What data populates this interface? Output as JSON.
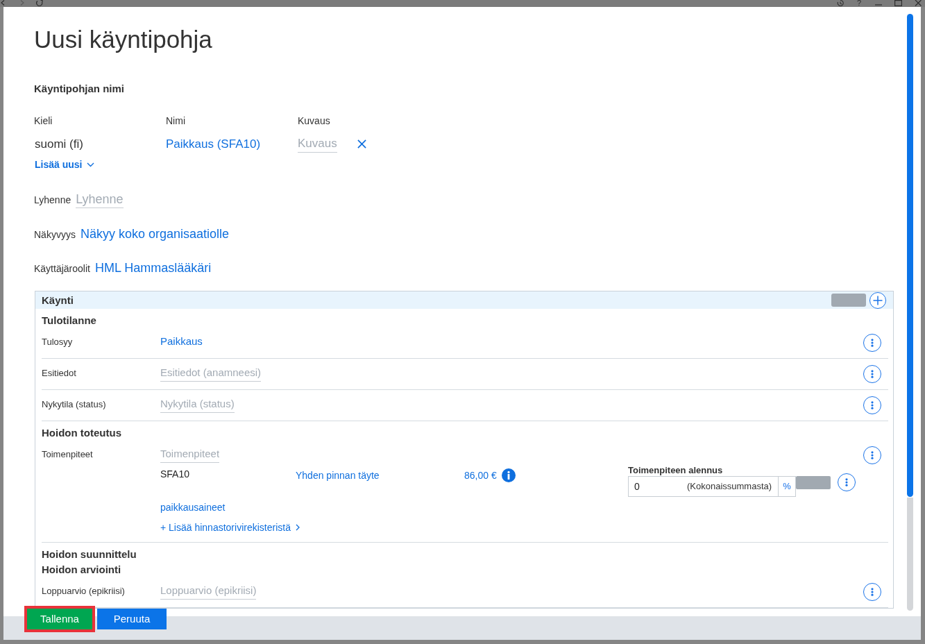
{
  "browser_toolbar": {
    "help": "?"
  },
  "dialog": {
    "title": "Uusi käyntipohja"
  },
  "name_section": {
    "heading": "Käyntipohjan nimi",
    "columns": [
      "Kieli",
      "Nimi",
      "Kuvaus"
    ],
    "rows": [
      {
        "language": "suomi (fi)",
        "name": "Paikkaus (SFA10)",
        "description": {
          "placeholder": "Kuvaus"
        }
      }
    ],
    "add_new": "Lisää uusi"
  },
  "fields": [
    {
      "label": "Lyhenne",
      "kind": "input",
      "placeholder": "Lyhenne"
    },
    {
      "label": "Näkyvyys",
      "kind": "link",
      "value": "Näkyy koko organisaatiolle"
    },
    {
      "label": "Käyttäjäroolit",
      "kind": "link",
      "value": "HML Hammaslääkäri"
    }
  ],
  "panel": {
    "title": "Käynti",
    "groups": [
      {
        "heading": "Tulotilanne",
        "rows": [
          {
            "label": "Tulosyy",
            "kind": "link",
            "value": "Paikkaus"
          },
          {
            "label": "Esitiedot",
            "kind": "input",
            "placeholder": "Esitiedot (anamneesi)"
          },
          {
            "label": "Nykytila (status)",
            "kind": "input",
            "placeholder": "Nykytila (status)"
          }
        ]
      },
      {
        "heading": "Hoidon toteutus",
        "rows": [
          {
            "label": "Toimenpiteet",
            "kind": "procedures",
            "placeholder": "Toimenpiteet",
            "items": [
              {
                "code": "SFA10",
                "name": "Yhden pinnan täyte",
                "price": "86,00 €",
                "discount": {
                  "label": "Toimenpiteen alennus",
                  "value": "0",
                  "suffix": "(Kokonaissummasta)",
                  "unit": "%"
                }
              }
            ],
            "materials": "paikkausaineet",
            "add_link": "+ Lisää hinnastorivirekisteristä"
          }
        ]
      },
      {
        "heading": "Hoidon suunnittelu"
      },
      {
        "heading": "Hoidon arviointi",
        "rows": [
          {
            "label": "Loppuarvio (epikriisi)",
            "kind": "input",
            "placeholder": "Loppuarvio (epikriisi)"
          }
        ]
      }
    ]
  },
  "buttons": [
    {
      "label": "Tallenna",
      "kind": "primary",
      "highlighted": true
    },
    {
      "label": "Peruuta",
      "kind": "secondary",
      "highlighted": false
    }
  ]
}
